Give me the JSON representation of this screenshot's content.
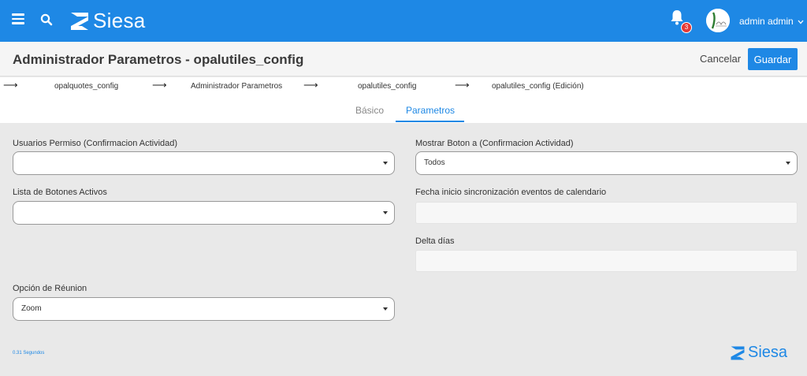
{
  "header": {
    "logo_text": "Siesa",
    "notification_count": "3",
    "user_name": "admin admin"
  },
  "titlebar": {
    "title": "Administrador Parametros - opalutiles_config",
    "cancel_label": "Cancelar",
    "save_label": "Guardar"
  },
  "breadcrumb": {
    "items": [
      "opalquotes_config",
      "Administrador Parametros",
      "opalutiles_config",
      "opalutiles_config (Edición)"
    ]
  },
  "tabs": [
    {
      "label": "Básico"
    },
    {
      "label": "Parametros"
    }
  ],
  "form": {
    "usuarios_permiso": {
      "label": "Usuarios Permiso (Confirmacion Actividad)",
      "value": ""
    },
    "mostrar_boton": {
      "label": "Mostrar Boton a (Confirmacion Actividad)",
      "value": "Todos"
    },
    "lista_botones": {
      "label": "Lista de Botones Activos",
      "value": ""
    },
    "fecha_inicio": {
      "label": "Fecha inicio sincronización eventos de calendario",
      "value": ""
    },
    "delta_dias": {
      "label": "Delta días",
      "value": ""
    },
    "opcion_reunion": {
      "label": "Opción de Réunion",
      "value": "Zoom"
    }
  },
  "footer": {
    "timing": "0.31 Segundos",
    "logo_text": "Siesa"
  },
  "colors": {
    "primary": "#1e88e5",
    "badge": "#e53935"
  }
}
